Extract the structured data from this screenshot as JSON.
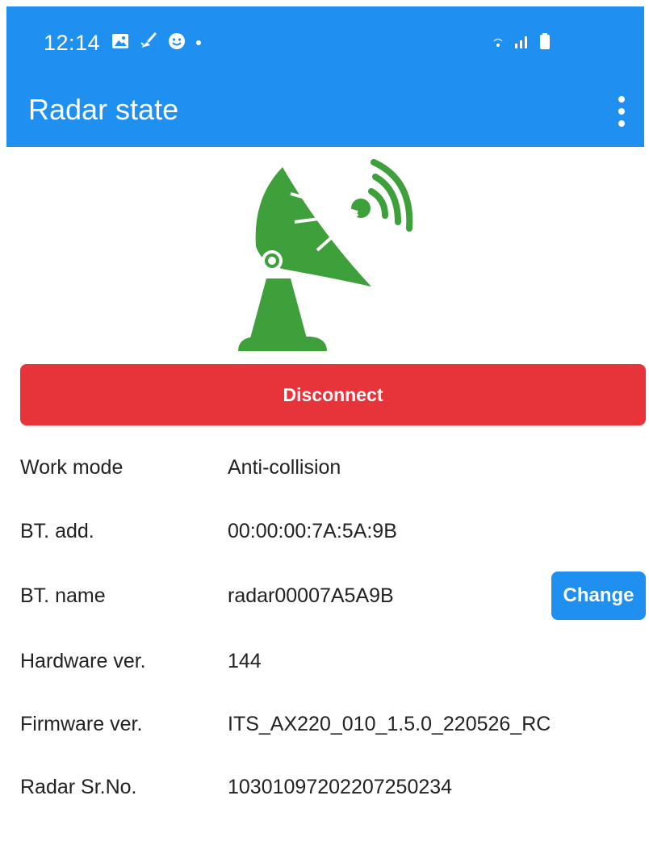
{
  "status_bar": {
    "time": "12:14",
    "left_icons": [
      "gallery-icon",
      "cleaner-icon",
      "emoji-icon",
      "dot-icon"
    ],
    "right_icons": [
      "wifi-icon",
      "signal-icon",
      "battery-icon"
    ]
  },
  "toolbar": {
    "title": "Radar state",
    "overflow_icon": "more-vert-icon"
  },
  "illustration": {
    "icon": "satellite-dish-icon",
    "color": "#3ea03a"
  },
  "actions": {
    "disconnect_label": "Disconnect",
    "disconnect_color": "#e7343b",
    "change_label": "Change",
    "change_color": "#1f8ff0"
  },
  "info": {
    "work_mode": {
      "label": "Work mode",
      "value": "Anti-collision"
    },
    "bt_address": {
      "label": "BT. add.",
      "value": "00:00:00:7A:5A:9B"
    },
    "bt_name": {
      "label": "BT. name",
      "value": "radar00007A5A9B"
    },
    "hardware_version": {
      "label": "Hardware ver.",
      "value": "144"
    },
    "firmware_version": {
      "label": "Firmware ver.",
      "value": "ITS_AX220_010_1.5.0_220526_RC"
    },
    "radar_serial": {
      "label": "Radar Sr.No.",
      "value": "10301097202207250234"
    }
  },
  "theme": {
    "primary": "#1f8ff0",
    "danger": "#e7343b",
    "accent_green": "#3ea03a"
  }
}
